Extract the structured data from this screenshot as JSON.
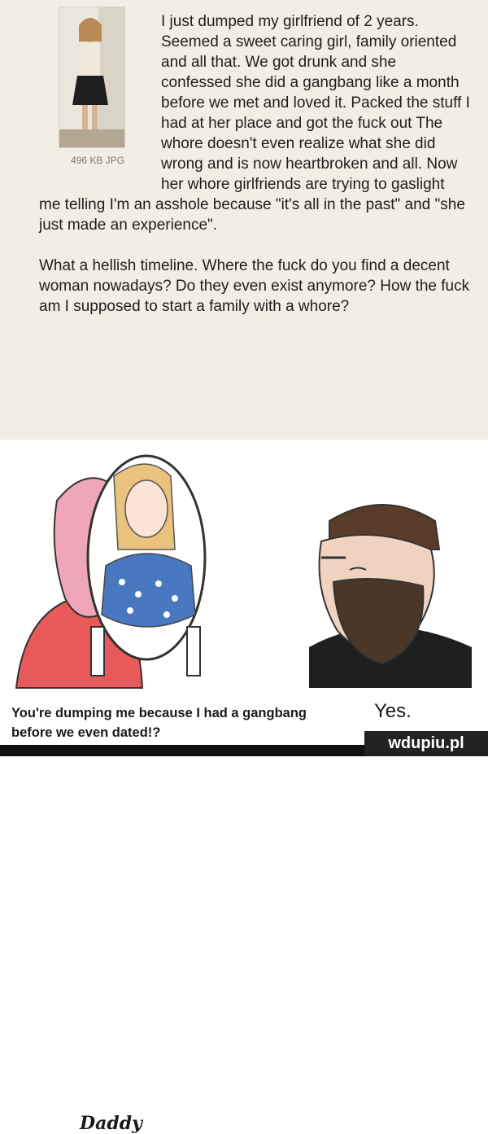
{
  "post": {
    "file_info": "496 KB JPG",
    "paragraphs": [
      "I just dumped my girlfriend of 2 years. Seemed a sweet caring girl, family oriented and all that. We got drunk and she confessed she did a gangbang like a month before we met and loved it. Packed the stuff I had at her place and got the fuck out The whore doesn't even realize what she did wrong and is now heartbroken and all. Now her whore girlfriends are trying to gaslight me telling I'm an asshole because \"it's all in the past\" and \"she just made an experience\".",
      "What a hellish timeline. Where the fuck do you find a decent woman nowadays? Do they even exist anymore? How the fuck am I supposed to start a family with a whore?"
    ]
  },
  "meme": {
    "left_caption": "You're dumping me because I had a gangbang before we even dated!?",
    "left_sign": "Daddy",
    "right_caption": "Yes."
  },
  "watermark": "wdupiu.pl",
  "colors": {
    "post_bg": "#f2eee3",
    "shirt": "#e85a5a",
    "hair": "#f0a6b9",
    "beard": "#4a3728"
  }
}
